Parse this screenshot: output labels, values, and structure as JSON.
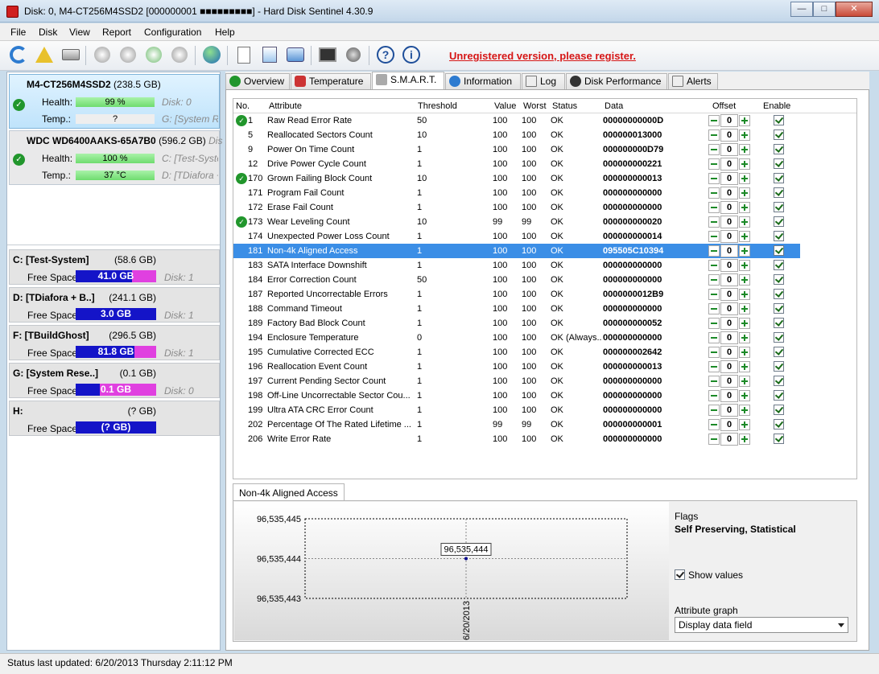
{
  "window": {
    "title": "Disk: 0, M4-CT256M4SSD2 [000000001 ■■■■■■■■■]  -  Hard Disk Sentinel 4.30.9"
  },
  "menu": [
    "File",
    "Disk",
    "View",
    "Report",
    "Configuration",
    "Help"
  ],
  "toolbar": {
    "register": "Unregistered version, please register."
  },
  "disks": [
    {
      "name": "M4-CT256M4SSD2",
      "size": "(238.5 GB)",
      "health_label": "Health:",
      "health": "99 %",
      "temp_label": "Temp.:",
      "temp": "?",
      "side1": "Disk: 0",
      "side2": "G: [System Re"
    },
    {
      "name": "WDC WD6400AAKS-65A7B0",
      "size": "(596.2 GB)",
      "trail": "Dis",
      "health_label": "Health:",
      "health": "100 %",
      "temp_label": "Temp.:",
      "temp": "37 °C",
      "side1": "C: [Test-Syste",
      "side2": "D: [TDiafora +"
    }
  ],
  "volumes": [
    {
      "name": "C: [Test-System]",
      "size": "(58.6 GB)",
      "free_label": "Free Space",
      "free": "41.0 GB",
      "disk": "Disk: 1",
      "color": "#e040e0"
    },
    {
      "name": "D: [TDiafora + B..]",
      "size": "(241.1 GB)",
      "free_label": "Free Space",
      "free": "3.0 GB",
      "disk": "Disk: 1",
      "color": "#1414c8"
    },
    {
      "name": "F: [TBuildGhost]",
      "size": "(296.5 GB)",
      "free_label": "Free Space",
      "free": "81.8 GB",
      "disk": "Disk: 1",
      "color": "#e040e0"
    },
    {
      "name": "G: [System Rese..]",
      "size": "(0.1 GB)",
      "free_label": "Free Space",
      "free": "0.1 GB",
      "disk": "Disk: 0",
      "color": "#e040e0"
    },
    {
      "name": "H:",
      "size": "(? GB)",
      "free_label": "Free Space",
      "free": "(? GB)",
      "disk": "",
      "color": "#1414c8"
    }
  ],
  "tabs": [
    "Overview",
    "Temperature",
    "S.M.A.R.T.",
    "Information",
    "Log",
    "Disk Performance",
    "Alerts"
  ],
  "grid": {
    "headers": {
      "no": "No.",
      "attribute": "Attribute",
      "threshold": "Threshold",
      "value": "Value",
      "worst": "Worst",
      "status": "Status",
      "data": "Data",
      "offset": "Offset",
      "enable": "Enable"
    },
    "rows": [
      {
        "no": "1",
        "attr": "Raw Read Error Rate",
        "th": "50",
        "val": "100",
        "worst": "100",
        "status": "OK",
        "data": "00000000000D",
        "ok": true
      },
      {
        "no": "5",
        "attr": "Reallocated Sectors Count",
        "th": "10",
        "val": "100",
        "worst": "100",
        "status": "OK",
        "data": "000000013000"
      },
      {
        "no": "9",
        "attr": "Power On Time Count",
        "th": "1",
        "val": "100",
        "worst": "100",
        "status": "OK",
        "data": "000000000D79"
      },
      {
        "no": "12",
        "attr": "Drive Power Cycle Count",
        "th": "1",
        "val": "100",
        "worst": "100",
        "status": "OK",
        "data": "000000000221"
      },
      {
        "no": "170",
        "attr": "Grown Failing Block Count",
        "th": "10",
        "val": "100",
        "worst": "100",
        "status": "OK",
        "data": "000000000013",
        "ok": true
      },
      {
        "no": "171",
        "attr": "Program Fail Count",
        "th": "1",
        "val": "100",
        "worst": "100",
        "status": "OK",
        "data": "000000000000"
      },
      {
        "no": "172",
        "attr": "Erase Fail Count",
        "th": "1",
        "val": "100",
        "worst": "100",
        "status": "OK",
        "data": "000000000000"
      },
      {
        "no": "173",
        "attr": "Wear Leveling Count",
        "th": "10",
        "val": "99",
        "worst": "99",
        "status": "OK",
        "data": "000000000020",
        "ok": true
      },
      {
        "no": "174",
        "attr": "Unexpected Power Loss Count",
        "th": "1",
        "val": "100",
        "worst": "100",
        "status": "OK",
        "data": "000000000014"
      },
      {
        "no": "181",
        "attr": "Non-4k Aligned Access",
        "th": "1",
        "val": "100",
        "worst": "100",
        "status": "OK",
        "data": "095505C10394",
        "sel": true
      },
      {
        "no": "183",
        "attr": "SATA Interface Downshift",
        "th": "1",
        "val": "100",
        "worst": "100",
        "status": "OK",
        "data": "000000000000"
      },
      {
        "no": "184",
        "attr": "Error Correction Count",
        "th": "50",
        "val": "100",
        "worst": "100",
        "status": "OK",
        "data": "000000000000"
      },
      {
        "no": "187",
        "attr": "Reported Uncorrectable Errors",
        "th": "1",
        "val": "100",
        "worst": "100",
        "status": "OK",
        "data": "0000000012B9"
      },
      {
        "no": "188",
        "attr": "Command Timeout",
        "th": "1",
        "val": "100",
        "worst": "100",
        "status": "OK",
        "data": "000000000000"
      },
      {
        "no": "189",
        "attr": "Factory Bad Block Count",
        "th": "1",
        "val": "100",
        "worst": "100",
        "status": "OK",
        "data": "000000000052"
      },
      {
        "no": "194",
        "attr": "Enclosure Temperature",
        "th": "0",
        "val": "100",
        "worst": "100",
        "status": "OK (Always...",
        "data": "000000000000"
      },
      {
        "no": "195",
        "attr": "Cumulative Corrected ECC",
        "th": "1",
        "val": "100",
        "worst": "100",
        "status": "OK",
        "data": "000000002642"
      },
      {
        "no": "196",
        "attr": "Reallocation Event Count",
        "th": "1",
        "val": "100",
        "worst": "100",
        "status": "OK",
        "data": "000000000013"
      },
      {
        "no": "197",
        "attr": "Current Pending Sector Count",
        "th": "1",
        "val": "100",
        "worst": "100",
        "status": "OK",
        "data": "000000000000"
      },
      {
        "no": "198",
        "attr": "Off-Line Uncorrectable Sector Cou...",
        "th": "1",
        "val": "100",
        "worst": "100",
        "status": "OK",
        "data": "000000000000"
      },
      {
        "no": "199",
        "attr": "Ultra ATA CRC Error Count",
        "th": "1",
        "val": "100",
        "worst": "100",
        "status": "OK",
        "data": "000000000000"
      },
      {
        "no": "202",
        "attr": "Percentage Of The Rated Lifetime ...",
        "th": "1",
        "val": "99",
        "worst": "99",
        "status": "OK",
        "data": "000000000001"
      },
      {
        "no": "206",
        "attr": "Write Error Rate",
        "th": "1",
        "val": "100",
        "worst": "100",
        "status": "OK",
        "data": "000000000000"
      }
    ],
    "offset_value": "0"
  },
  "detail": {
    "tab": "Non-4k Aligned Access",
    "flags_label": "Flags",
    "flags": "Self Preserving, Statistical",
    "show_values": "Show values",
    "attr_graph_label": "Attribute graph",
    "attr_graph_value": "Display data field"
  },
  "chart_data": {
    "type": "line",
    "x": [
      "6/20/2013"
    ],
    "series": [
      {
        "values": [
          96535444
        ]
      }
    ],
    "point_labels": [
      "96,535,444"
    ],
    "ytick_labels": [
      "96,535,445",
      "96,535,444",
      "96,535,443"
    ],
    "ylim": [
      96535443,
      96535445
    ]
  },
  "status": "Status last updated: 6/20/2013 Thursday 2:11:12 PM"
}
